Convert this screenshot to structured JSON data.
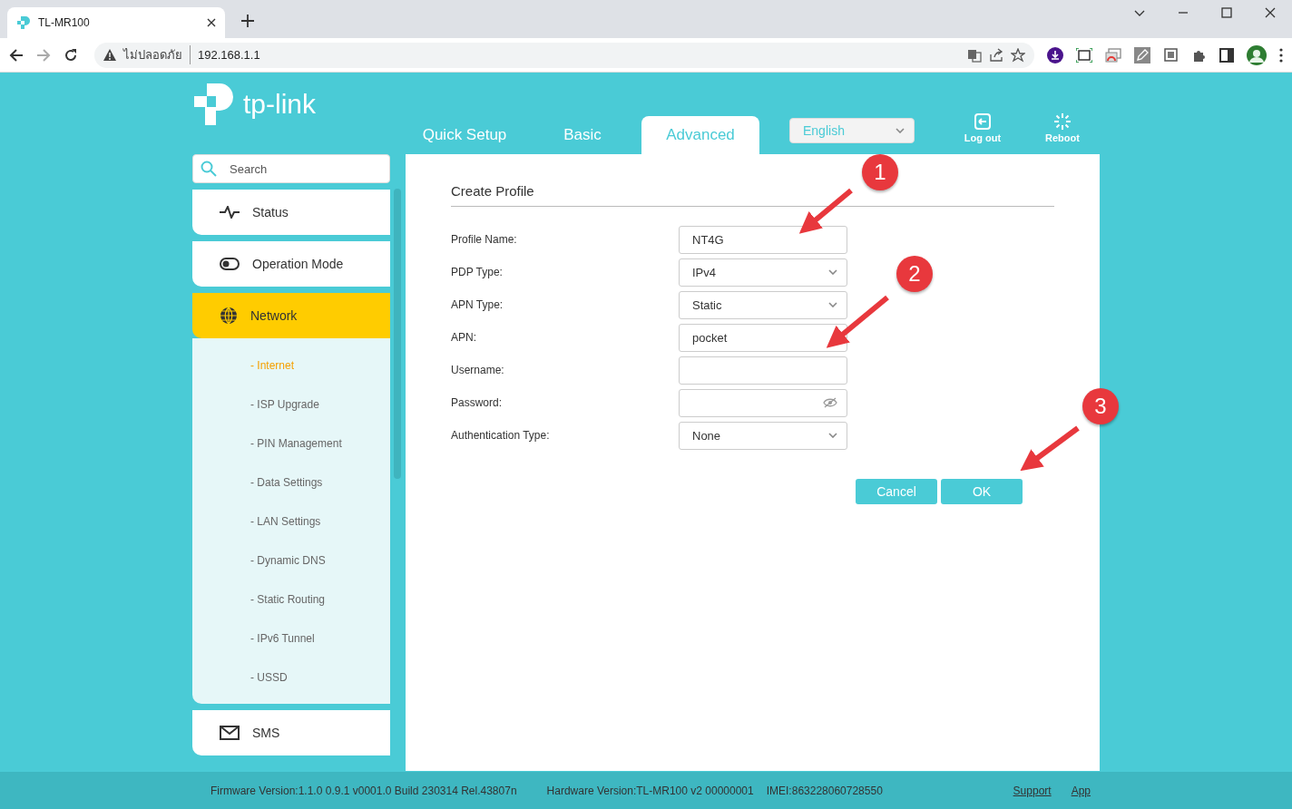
{
  "browser": {
    "tab_title": "TL-MR100",
    "security_label": "ไม่ปลอดภัย",
    "url": "192.168.1.1"
  },
  "header": {
    "logo_text": "tp-link",
    "tabs": [
      {
        "label": "Quick Setup",
        "selected": false
      },
      {
        "label": "Basic",
        "selected": false
      },
      {
        "label": "Advanced",
        "selected": true
      }
    ],
    "language": "English",
    "actions": [
      {
        "kind": "logout",
        "label": "Log out"
      },
      {
        "kind": "reboot",
        "label": "Reboot"
      }
    ]
  },
  "sidebar": {
    "search_placeholder": "Search",
    "items": [
      {
        "kind": "status",
        "label": "Status",
        "selected": false
      },
      {
        "kind": "mode",
        "label": "Operation Mode",
        "selected": false
      },
      {
        "kind": "network",
        "label": "Network",
        "selected": true,
        "children": [
          {
            "label": "- Internet",
            "selected": true
          },
          {
            "label": "- ISP Upgrade",
            "selected": false
          },
          {
            "label": "- PIN Management",
            "selected": false
          },
          {
            "label": "- Data Settings",
            "selected": false
          },
          {
            "label": "- LAN Settings",
            "selected": false
          },
          {
            "label": "- Dynamic DNS",
            "selected": false
          },
          {
            "label": "- Static Routing",
            "selected": false
          },
          {
            "label": "- IPv6 Tunnel",
            "selected": false
          },
          {
            "label": "- USSD",
            "selected": false
          }
        ]
      },
      {
        "kind": "sms",
        "label": "SMS",
        "selected": false
      }
    ]
  },
  "form": {
    "title": "Create Profile",
    "fields": [
      {
        "kind": "text",
        "label": "Profile Name:",
        "value": "NT4G"
      },
      {
        "kind": "select",
        "label": "PDP Type:",
        "value": "IPv4"
      },
      {
        "kind": "select",
        "label": "APN Type:",
        "value": "Static"
      },
      {
        "kind": "text",
        "label": "APN:",
        "value": "pocket"
      },
      {
        "kind": "text",
        "label": "Username:"
      },
      {
        "kind": "password",
        "label": "Password:"
      },
      {
        "kind": "select",
        "label": "Authentication Type:",
        "value": "None"
      }
    ],
    "buttons": [
      "Cancel",
      "OK"
    ]
  },
  "annotations": [
    "1",
    "2",
    "3"
  ],
  "footer": {
    "firmware": "Firmware Version:1.1.0 0.9.1 v0001.0 Build 230314 Rel.43807n",
    "hardware": "Hardware Version:TL-MR100 v2 00000001",
    "imei": "IMEI:863228060728550",
    "links": [
      "Support",
      "App"
    ]
  }
}
